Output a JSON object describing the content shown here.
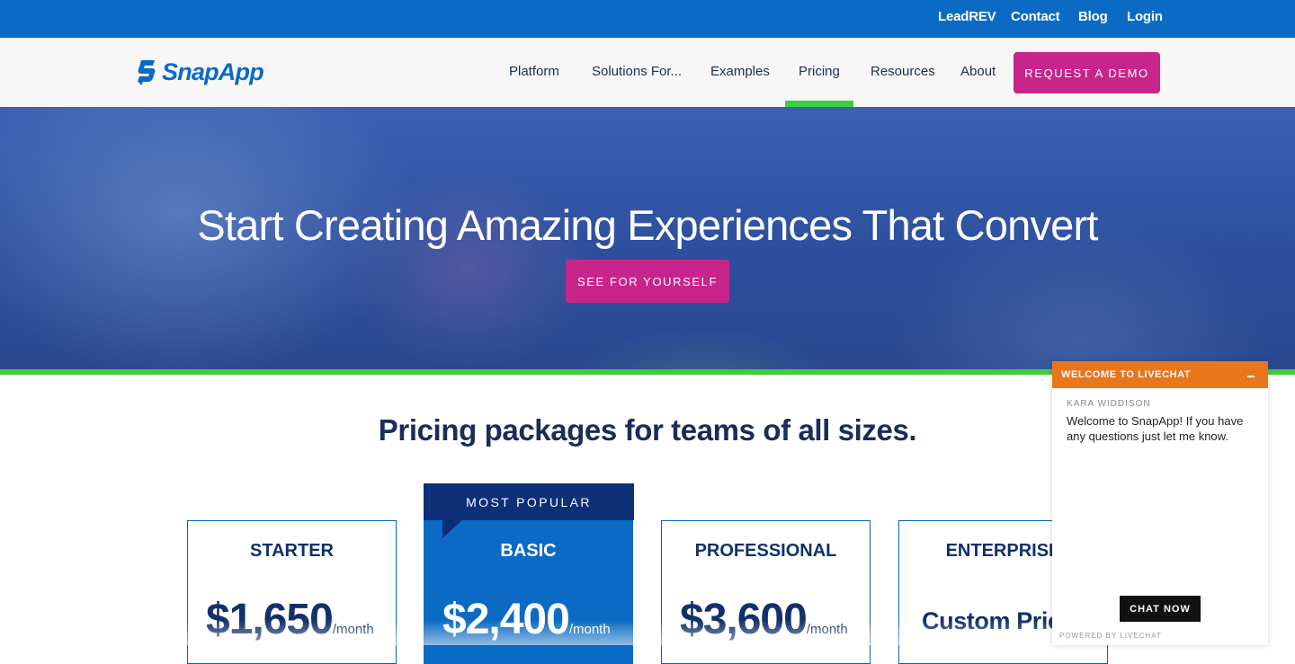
{
  "topbar": {
    "links": [
      "LeadREV",
      "Contact",
      "Blog",
      "Login"
    ]
  },
  "nav": {
    "brand": "SnapApp",
    "items": [
      "Platform",
      "Solutions For...",
      "Examples",
      "Pricing",
      "Resources",
      "About"
    ],
    "active_item": "Pricing",
    "cta_label": "REQUEST A DEMO"
  },
  "hero": {
    "headline": "Start Creating Amazing Experiences That Convert",
    "cta_label": "SEE FOR YOURSELF"
  },
  "pricing": {
    "heading": "Pricing packages for teams of all sizes.",
    "popular_badge": "MOST POPULAR",
    "plans": [
      {
        "name": "STARTER",
        "price": "$1,650",
        "period": "/month"
      },
      {
        "name": "BASIC",
        "price": "$2,400",
        "period": "/month"
      },
      {
        "name": "PROFESSIONAL",
        "price": "$3,600",
        "period": "/month"
      },
      {
        "name": "ENTERPRISE",
        "price": "Custom Pric"
      }
    ]
  },
  "livechat": {
    "header": "WELCOME TO LIVECHAT",
    "agent": "KARA WIDDISON",
    "message": "Welcome to SnapApp! If you have any questions just let me know.",
    "cta_label": "CHAT NOW",
    "footer": "POWERED BY LIVECHAT"
  },
  "colors": {
    "topbar": "#0b6bc4",
    "cta_magenta": "#c8258a",
    "active_green": "#3ecf3a",
    "navy_text": "#1a2c5a",
    "chat_orange": "#e8761d"
  },
  "icons": [
    "snapapp-logo-icon",
    "minimize-icon"
  ]
}
